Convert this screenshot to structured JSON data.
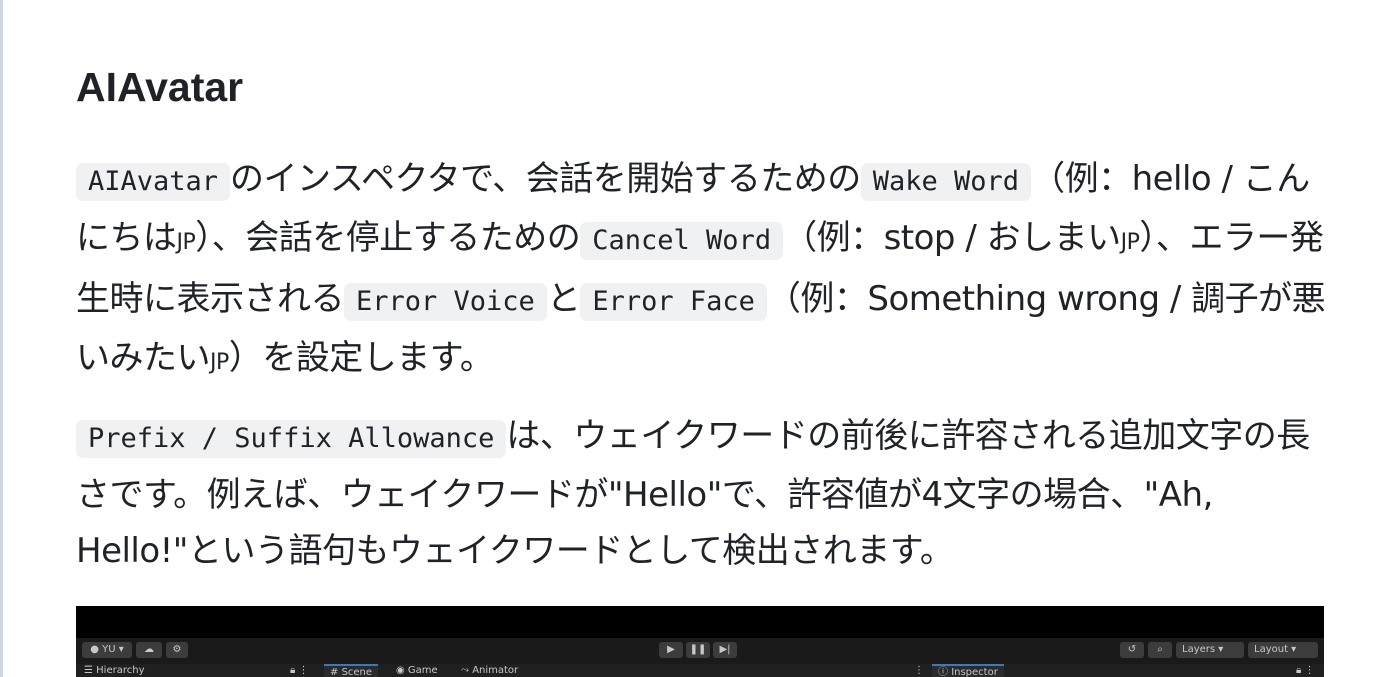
{
  "heading": "AIAvatar",
  "para1": {
    "c1": "AIAvatar",
    "t1": "のインスペクタで、会話を開始するための",
    "c2": "Wake Word",
    "t2": "（例：hello / こんにちは",
    "jp1": "jp",
    "t3": "）、会話を停止するための",
    "c3": "Cancel Word",
    "t4": "（例：stop / おしまい",
    "jp2": "jp",
    "t5": "）、エラー発生時に表示される",
    "c4": "Error Voice",
    "t6": "と",
    "c5": "Error Face",
    "t7": "（例：Something wrong / 調子が悪いみたい",
    "jp3": "jp",
    "t8": "）を設定します。"
  },
  "para2": {
    "c1": "Prefix / Suffix Allowance",
    "t1": "は、ウェイクワードの前後に許容される追加文字の長さです。例えば、ウェイクワードが\"Hello\"で、許容値が4文字の場合、\"Ah, Hello!\"という語句もウェイクワードとして検出されます。"
  },
  "unity": {
    "account": "YU ▾",
    "layers": "Layers",
    "layout": "Layout",
    "hierarchy_tab": "Hierarchy",
    "scene_tab": "Scene",
    "game_tab": "Game",
    "animator_tab": "Animator",
    "inspector_tab": "Inspector"
  }
}
